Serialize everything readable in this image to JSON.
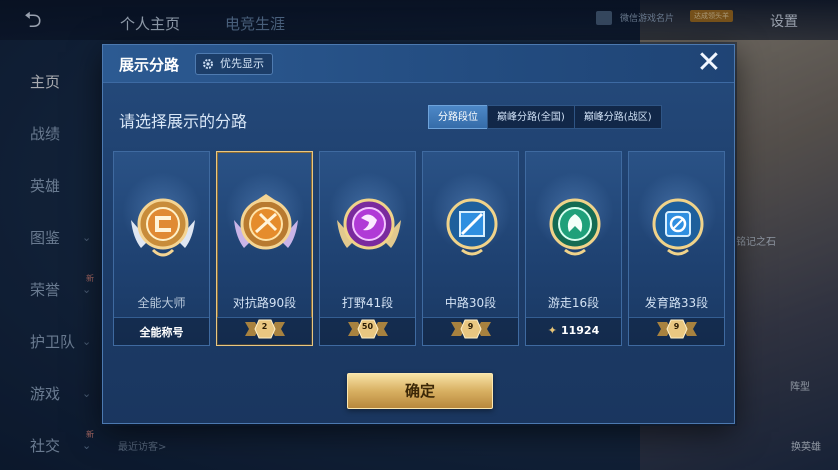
{
  "background": {
    "top_tabs": [
      "个人主页",
      "电竞生涯"
    ],
    "profile_name": "微信游戏名片",
    "profile_badge": "达成领头羊",
    "settings_label": "设置",
    "side_nav": [
      {
        "label": "主页",
        "active": true,
        "chevron": false,
        "new": false
      },
      {
        "label": "战绩",
        "active": false,
        "chevron": false,
        "new": false
      },
      {
        "label": "英雄",
        "active": false,
        "chevron": false,
        "new": false
      },
      {
        "label": "图鉴",
        "active": false,
        "chevron": true,
        "new": false
      },
      {
        "label": "荣誉",
        "active": false,
        "chevron": true,
        "new": true
      },
      {
        "label": "护卫队",
        "active": false,
        "chevron": true,
        "new": false
      },
      {
        "label": "游戏",
        "active": false,
        "chevron": true,
        "new": false
      },
      {
        "label": "社交",
        "active": false,
        "chevron": true,
        "new": true
      }
    ],
    "new_tag": "新",
    "recent_visitors": "最近访客>",
    "right_stone": "铭记之石",
    "right_btn1": "阵型",
    "right_btn2": "换英雄"
  },
  "modal": {
    "title": "展示分路",
    "priority_label": "优先显示",
    "subtitle": "请选择展示的分路",
    "tabs": [
      {
        "label": "分路段位",
        "active": true
      },
      {
        "label": "巅峰分路(全国)",
        "active": false
      },
      {
        "label": "巅峰分路(战区)",
        "active": false
      }
    ],
    "cards": [
      {
        "label": "全能大师",
        "value": "全能称号",
        "kind": "title",
        "selected": false,
        "accent": "#e08a34"
      },
      {
        "label": "对抗路90段",
        "value": "2",
        "kind": "rank",
        "selected": true,
        "accent": "#e08a34"
      },
      {
        "label": "打野41段",
        "value": "50",
        "kind": "rank",
        "selected": false,
        "accent": "#b03ad6"
      },
      {
        "label": "中路30段",
        "value": "9",
        "kind": "rank",
        "selected": false,
        "accent": "#2f8fe0"
      },
      {
        "label": "游走16段",
        "value": "11924",
        "kind": "score",
        "selected": false,
        "accent": "#1fa07a"
      },
      {
        "label": "发育路33段",
        "value": "9",
        "kind": "rank",
        "selected": false,
        "accent": "#2f8fe0"
      }
    ],
    "confirm_label": "确定",
    "close_icon": "close-icon",
    "gear_icon": "gear-icon"
  }
}
